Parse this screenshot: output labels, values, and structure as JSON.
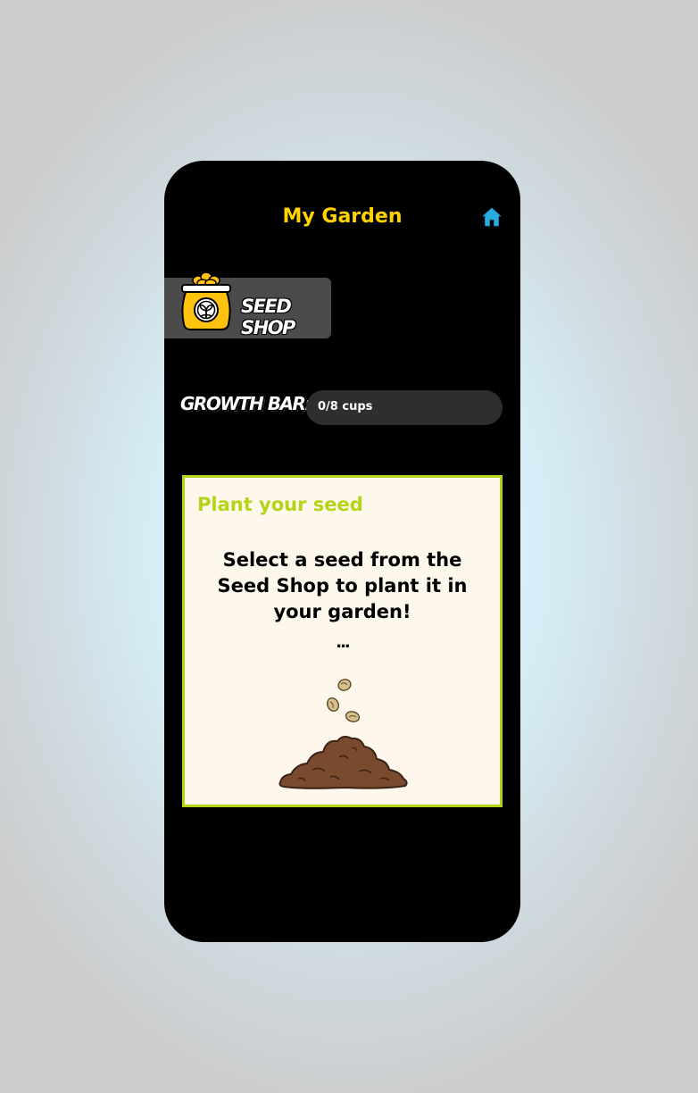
{
  "header": {
    "title": "My Garden",
    "home_icon": "home-icon"
  },
  "seed_shop": {
    "label": "SEED SHOP",
    "icon": "seed-bag-icon"
  },
  "growth": {
    "label": "GROWTH BAR:",
    "text": "0/8 cups",
    "progress": 0
  },
  "panel": {
    "title": "Plant your seed",
    "message": "Select a seed from the Seed Shop to plant it in your garden!",
    "dots": "...",
    "illustration": "seeds-falling-on-soil"
  },
  "colors": {
    "title": "#ffd200",
    "home": "#29abe2",
    "panel_border": "#b5d417",
    "panel_bg": "#fdf8eb",
    "soil": "#7a4a2e"
  }
}
